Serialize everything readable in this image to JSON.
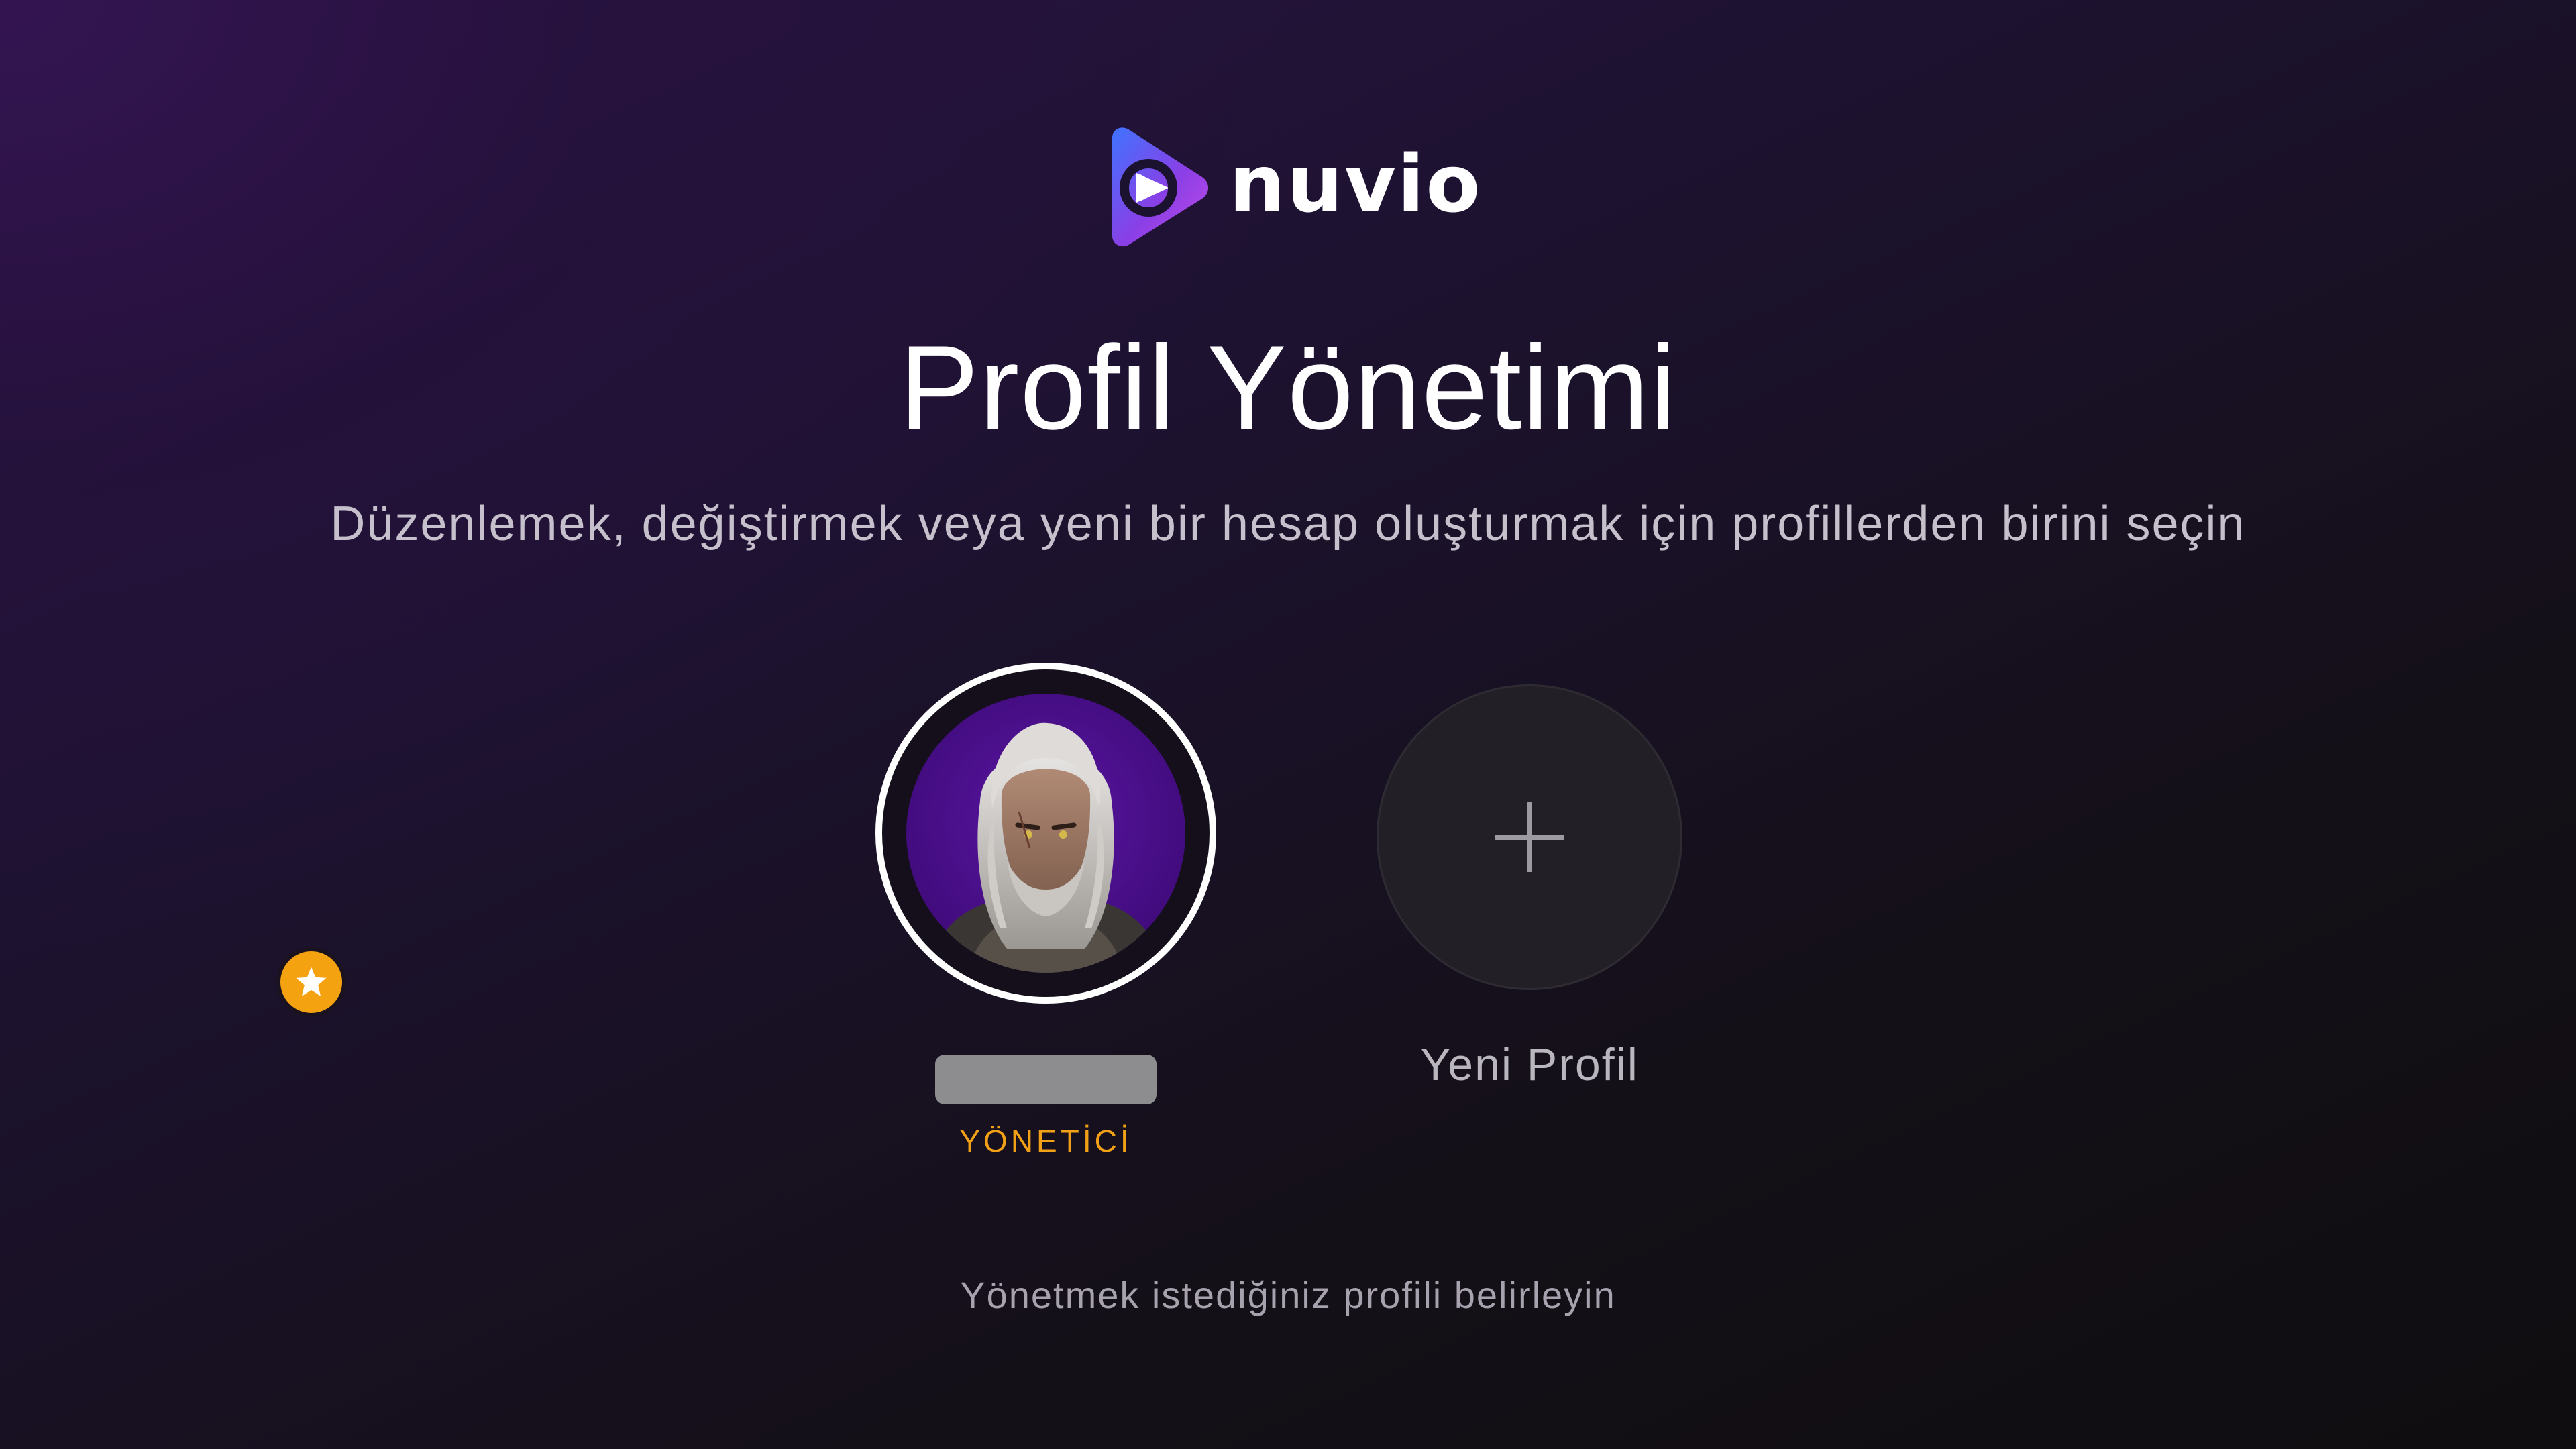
{
  "app": {
    "logo_text": "nuvio",
    "logo_icon": "play-triangle-icon",
    "accent_colors": [
      "#4b7bff",
      "#a44cf0",
      "#6a2ed8"
    ]
  },
  "header": {
    "title": "Profil Yönetimi",
    "subtitle": "Düzenlemek, değiştirmek veya yeni bir hesap oluşturmak için profillerden birini seçin"
  },
  "profiles": [
    {
      "name": "",
      "name_redacted": true,
      "role": "YÖNETİCİ",
      "role_color": "#f2a116",
      "badge_icon": "star-icon",
      "badge_color": "#f5a211",
      "avatar_ring_color": "#ffffff",
      "avatar_background": "#4c0f8c",
      "selected": true
    }
  ],
  "new_profile": {
    "label": "Yeni Profil",
    "icon": "plus-icon"
  },
  "footer": {
    "hint": "Yönetmek istediğiniz profili belirleyin"
  }
}
